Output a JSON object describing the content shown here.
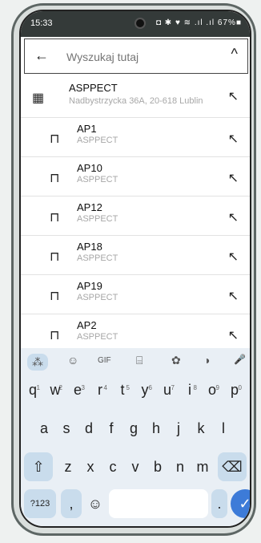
{
  "status": {
    "time": "15:33",
    "icons": "◘ ✱ ♥ ≋ .ıl .ıl 67%■"
  },
  "search": {
    "placeholder": "Wyszukaj tutaj",
    "back": "←",
    "collapse": "^"
  },
  "places": [
    {
      "title": "ASPPECT",
      "subtitle": "Nadbystrzycka 36A, 20-618 Lublin",
      "icon": "building-icon"
    },
    {
      "title": "AP1",
      "subtitle": "ASPPECT",
      "icon": "door-icon"
    },
    {
      "title": "AP10",
      "subtitle": "ASPPECT",
      "icon": "door-icon"
    },
    {
      "title": "AP12",
      "subtitle": "ASPPECT",
      "icon": "door-icon"
    },
    {
      "title": "AP18",
      "subtitle": "ASPPECT",
      "icon": "door-icon"
    },
    {
      "title": "AP19",
      "subtitle": "ASPPECT",
      "icon": "door-icon"
    },
    {
      "title": "AP2",
      "subtitle": "ASPPECT",
      "icon": "door-icon"
    }
  ],
  "keyboard": {
    "toolbar": [
      "⁂",
      "☺",
      "GIF",
      "⌸",
      "✿",
      "◑",
      "🎤"
    ],
    "row1": [
      "q",
      "w",
      "e",
      "r",
      "t",
      "y",
      "u",
      "i",
      "o",
      "p"
    ],
    "row1_hints": [
      "1",
      "2",
      "3",
      "4",
      "5",
      "6",
      "7",
      "8",
      "9",
      "0"
    ],
    "row2": [
      "a",
      "s",
      "d",
      "f",
      "g",
      "h",
      "j",
      "k",
      "l"
    ],
    "row3": [
      "z",
      "x",
      "c",
      "v",
      "b",
      "n",
      "m"
    ],
    "symbols": "?123",
    "comma": ",",
    "emoji": "☺",
    "period": ".",
    "enter": "✓",
    "shift": "⇧",
    "backspace": "⌫"
  }
}
